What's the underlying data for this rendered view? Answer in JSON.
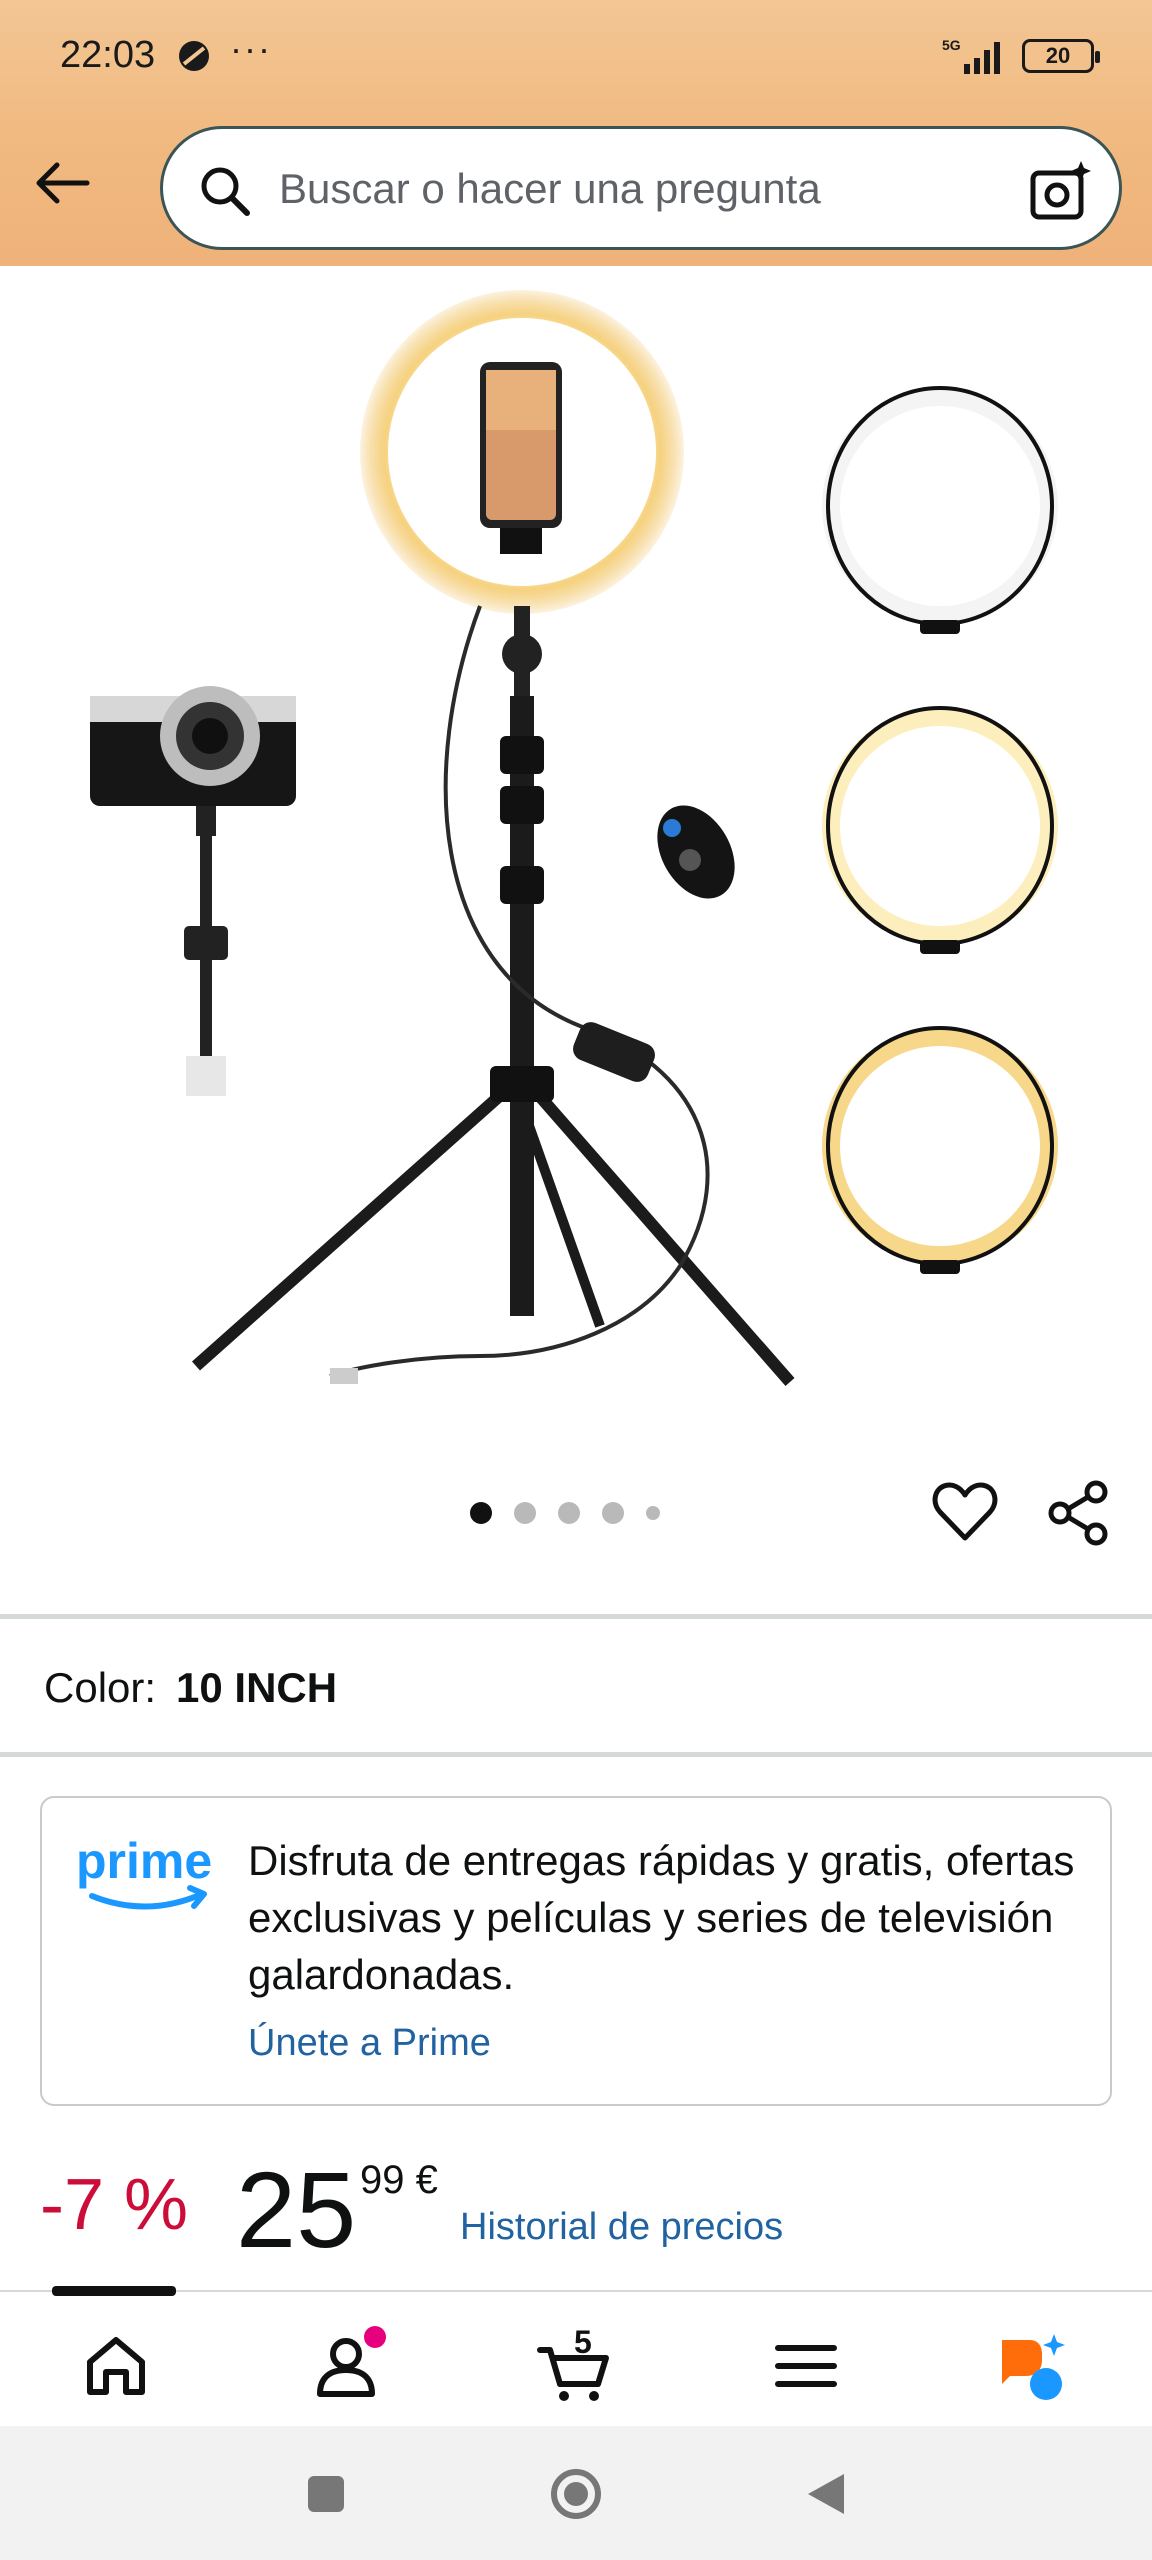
{
  "status_bar": {
    "time": "22:03",
    "more": "···",
    "network": "5G",
    "battery": "20"
  },
  "header": {
    "search_placeholder": "Buscar o hacer una pregunta",
    "back_icon": "arrow-left-icon",
    "search_icon": "search-icon",
    "camera_icon": "camera-sparkle-icon"
  },
  "gallery": {
    "image_count": 5,
    "active_index": 0
  },
  "variation": {
    "label": "Color:",
    "value": "10 INCH"
  },
  "prime": {
    "logo_text": "prime",
    "description": "Disfruta de entregas rápidas y gratis, ofertas exclusivas y películas y series de televisión galardonadas.",
    "link": "Únete a Prime"
  },
  "price": {
    "discount": "-7 %",
    "whole": "25",
    "fraction": "99 €",
    "history_link": "Historial de precios"
  },
  "bottom_nav": {
    "items": [
      "home-icon",
      "account-icon",
      "cart-icon",
      "menu-icon",
      "rufus-icon"
    ],
    "cart_count": "5"
  },
  "colors": {
    "header_bg": "#f0b87e",
    "link": "#2162a1",
    "discount": "#cc0c39",
    "prime_blue": "#1a98ff"
  }
}
